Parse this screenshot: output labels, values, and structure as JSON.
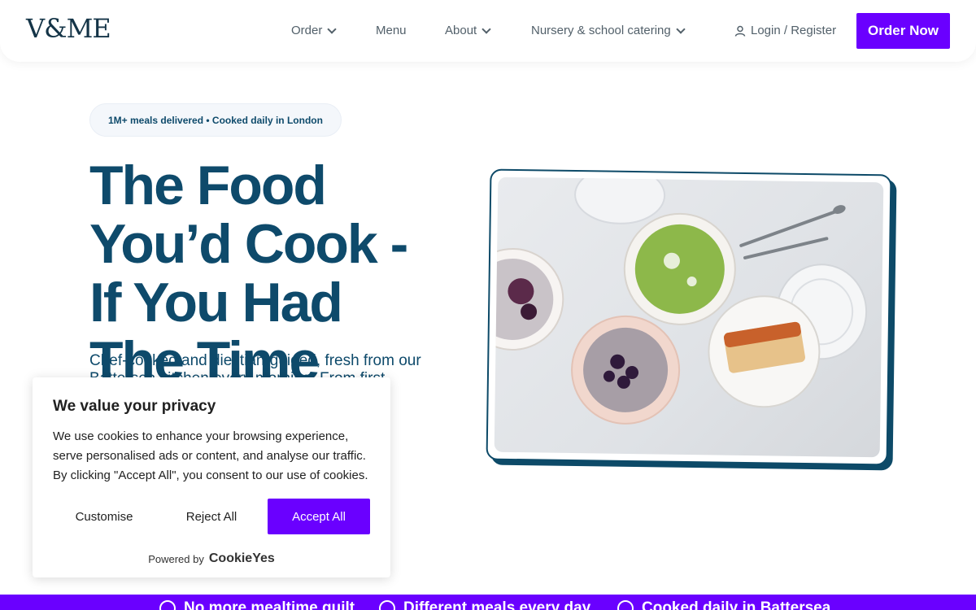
{
  "header": {
    "logo": "V&ME",
    "nav": [
      {
        "label": "Order",
        "has_dropdown": true
      },
      {
        "label": "Menu",
        "has_dropdown": false
      },
      {
        "label": "About",
        "has_dropdown": true
      },
      {
        "label": "Nursery & school catering",
        "has_dropdown": true
      }
    ],
    "login_label": "Login / Register",
    "cta_label": "Order Now"
  },
  "hero": {
    "badge": "1M+ meals delivered • Cooked daily in London",
    "title": "The Food You’d Cook - If You Had The Time",
    "subtitle": "Chef-cooked and dietitian-guided, fresh from our Battersea kitchen every morning. From first"
  },
  "cookie": {
    "title": "We value your privacy",
    "text": "We use cookies to enhance your browsing experience, serve personalised ads or content, and analyse our traffic. By clicking \"Accept All\", you consent to our use of cookies.",
    "customise": "Customise",
    "reject": "Reject All",
    "accept": "Accept All",
    "powered_by": "Powered by",
    "provider": "CookieYes"
  },
  "bottom_bar": {
    "items": [
      "No more mealtime guilt",
      "Different meals every day",
      "Cooked daily in Battersea"
    ]
  },
  "colors": {
    "accent": "#6a00ff",
    "navy": "#0e4a6b"
  }
}
